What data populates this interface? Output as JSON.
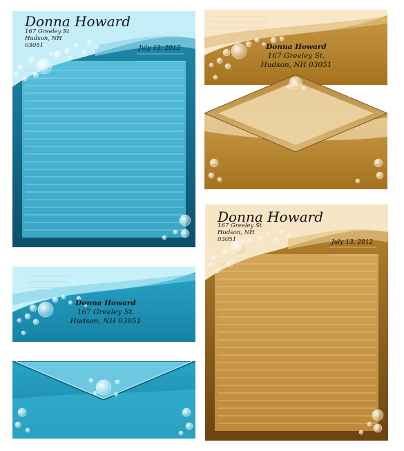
{
  "sender": {
    "name": "Donna Howard",
    "street": "167 Greeley St",
    "street_envelope": "167 Greeley St.",
    "city_line": "Hudson, NH",
    "zip": "03051",
    "city_state_zip": "Hudson, NH 03051"
  },
  "letter": {
    "date": "July 13, 2012"
  },
  "themes": {
    "blue": {
      "primary": "#1d93b5",
      "dark": "#0d5a78",
      "light": "#c7eef8",
      "paper": "#45b3d0"
    },
    "gold": {
      "primary": "#b8862b",
      "dark": "#6a4613",
      "light": "#f7e5c3",
      "paper": "#c99643"
    }
  }
}
